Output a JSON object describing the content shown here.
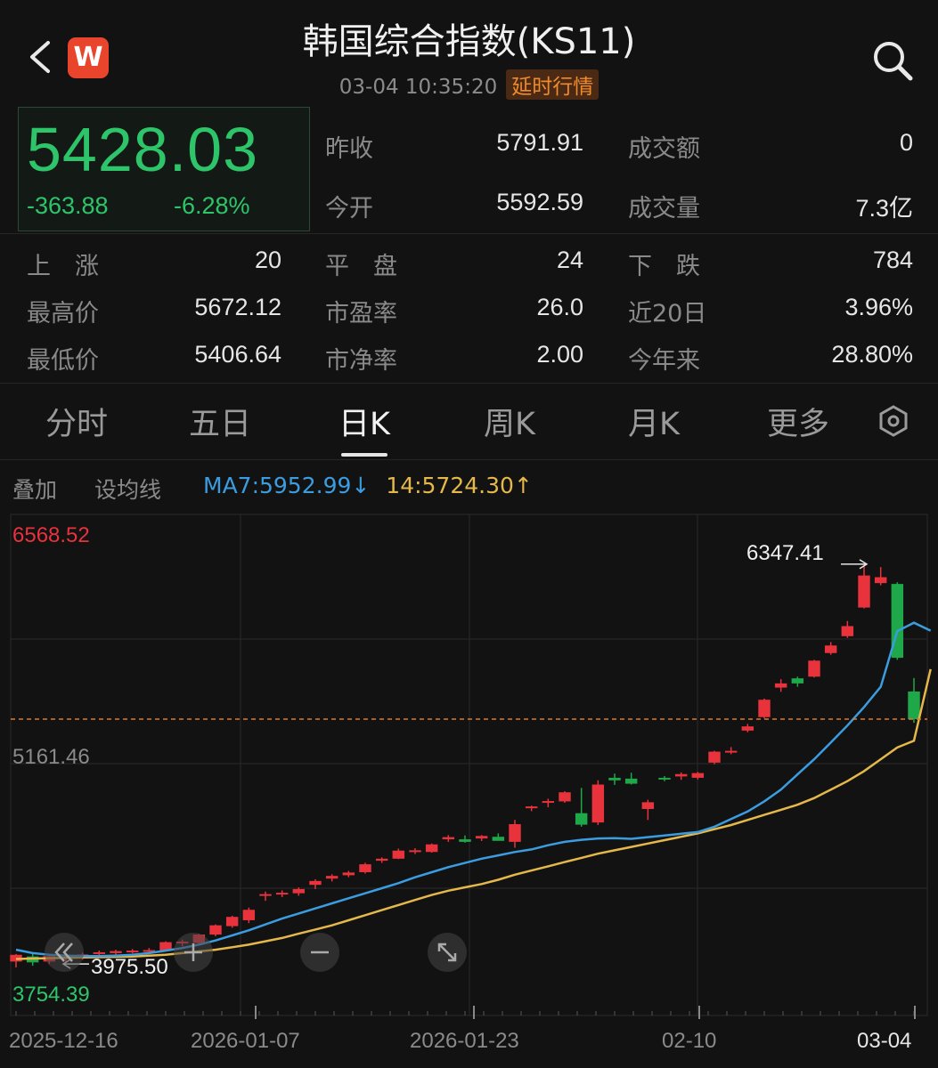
{
  "header": {
    "title": "韩国综合指数(KS11)",
    "datetime": "03-04 10:35:20",
    "delay_tag": "延时行情",
    "logo_letter": "W"
  },
  "quote": {
    "price": "5428.03",
    "change": "-363.88",
    "change_pct": "-6.28%",
    "fields": [
      {
        "label": "昨收",
        "value": "5791.91"
      },
      {
        "label": "今开",
        "value": "5592.59"
      },
      {
        "label": "成交额",
        "value": "0"
      },
      {
        "label": "成交量",
        "value": "7.3亿"
      }
    ]
  },
  "stats": {
    "up_label": "上　涨",
    "up_value": "20",
    "flat_label": "平　盘",
    "flat_value": "24",
    "down_label": "下　跌",
    "down_value": "784",
    "high_label": "最高价",
    "high_value": "5672.12",
    "pe_label": "市盈率",
    "pe_value": "26.0",
    "d20_label": "近20日",
    "d20_value": "3.96%",
    "low_label": "最低价",
    "low_value": "5406.64",
    "pb_label": "市净率",
    "pb_value": "2.00",
    "ytd_label": "今年来",
    "ytd_value": "28.80%"
  },
  "tabs": [
    "分时",
    "五日",
    "日K",
    "周K",
    "月K",
    "更多"
  ],
  "active_tab": "日K",
  "toolbar": {
    "overlay": "叠加",
    "set_ma": "设均线",
    "ma7_text": "MA7:5952.99↓",
    "ma14_text": "14:5724.30↑"
  },
  "chart_data": {
    "type": "candlestick",
    "y_max_label": "6568.52",
    "y_mid_label": "5161.46",
    "y_min_label": "3754.39",
    "high_marker": "6347.41",
    "low_marker": "3975.50",
    "dates": [
      "2025-12-16",
      "2026-01-07",
      "2026-01-23",
      "02-10",
      "03-04"
    ],
    "ylim": [
      3754.39,
      6568.52
    ],
    "current_price": 5428.03,
    "colors": {
      "up": "#e8323c",
      "down": "#1fa84a",
      "ma7": "#3b9de0",
      "ma14": "#e4b84a"
    },
    "candles": [
      {
        "o": 3990,
        "h": 4035,
        "l": 3955,
        "c": 4030
      },
      {
        "o": 4020,
        "h": 4040,
        "l": 3965,
        "c": 3985
      },
      {
        "o": 3990,
        "h": 4035,
        "l": 3975,
        "c": 4022
      },
      {
        "o": 4010,
        "h": 4035,
        "l": 3985,
        "c": 4028
      },
      {
        "o": 4015,
        "h": 4042,
        "l": 4000,
        "c": 4032
      },
      {
        "o": 4040,
        "h": 4055,
        "l": 4025,
        "c": 4045
      },
      {
        "o": 4040,
        "h": 4060,
        "l": 4028,
        "c": 4052
      },
      {
        "o": 4045,
        "h": 4064,
        "l": 4038,
        "c": 4055
      },
      {
        "o": 4050,
        "h": 4070,
        "l": 4045,
        "c": 4058
      },
      {
        "o": 4055,
        "h": 4110,
        "l": 4050,
        "c": 4105
      },
      {
        "o": 4098,
        "h": 4120,
        "l": 4080,
        "c": 4108
      },
      {
        "o": 4100,
        "h": 4155,
        "l": 4095,
        "c": 4150
      },
      {
        "o": 4150,
        "h": 4210,
        "l": 4140,
        "c": 4205
      },
      {
        "o": 4200,
        "h": 4262,
        "l": 4190,
        "c": 4255
      },
      {
        "o": 4235,
        "h": 4310,
        "l": 4218,
        "c": 4297
      },
      {
        "o": 4380,
        "h": 4405,
        "l": 4350,
        "c": 4390
      },
      {
        "o": 4388,
        "h": 4412,
        "l": 4372,
        "c": 4398
      },
      {
        "o": 4395,
        "h": 4430,
        "l": 4380,
        "c": 4420
      },
      {
        "o": 4445,
        "h": 4478,
        "l": 4420,
        "c": 4468
      },
      {
        "o": 4482,
        "h": 4508,
        "l": 4465,
        "c": 4498
      },
      {
        "o": 4502,
        "h": 4528,
        "l": 4490,
        "c": 4518
      },
      {
        "o": 4520,
        "h": 4576,
        "l": 4512,
        "c": 4567
      },
      {
        "o": 4588,
        "h": 4608,
        "l": 4575,
        "c": 4600
      },
      {
        "o": 4600,
        "h": 4660,
        "l": 4598,
        "c": 4648
      },
      {
        "o": 4645,
        "h": 4662,
        "l": 4628,
        "c": 4650
      },
      {
        "o": 4640,
        "h": 4690,
        "l": 4636,
        "c": 4685
      },
      {
        "o": 4715,
        "h": 4740,
        "l": 4700,
        "c": 4728
      },
      {
        "o": 4715,
        "h": 4738,
        "l": 4695,
        "c": 4700
      },
      {
        "o": 4720,
        "h": 4740,
        "l": 4705,
        "c": 4735
      },
      {
        "o": 4730,
        "h": 4750,
        "l": 4712,
        "c": 4706
      },
      {
        "o": 4700,
        "h": 4830,
        "l": 4665,
        "c": 4805
      },
      {
        "o": 4902,
        "h": 4915,
        "l": 4882,
        "c": 4910
      },
      {
        "o": 4942,
        "h": 4956,
        "l": 4905,
        "c": 4942
      },
      {
        "o": 4940,
        "h": 5000,
        "l": 4932,
        "c": 4994
      },
      {
        "o": 4870,
        "h": 5020,
        "l": 4790,
        "c": 4802
      },
      {
        "o": 4815,
        "h": 5065,
        "l": 4800,
        "c": 5040
      },
      {
        "o": 5080,
        "h": 5105,
        "l": 5038,
        "c": 5065
      },
      {
        "o": 5075,
        "h": 5110,
        "l": 5040,
        "c": 5045
      },
      {
        "o": 4895,
        "h": 4950,
        "l": 4830,
        "c": 4935
      },
      {
        "o": 5080,
        "h": 5090,
        "l": 5060,
        "c": 5072
      },
      {
        "o": 5088,
        "h": 5112,
        "l": 5068,
        "c": 5102
      },
      {
        "o": 5080,
        "h": 5115,
        "l": 5070,
        "c": 5108
      },
      {
        "o": 5170,
        "h": 5240,
        "l": 5160,
        "c": 5235
      },
      {
        "o": 5235,
        "h": 5262,
        "l": 5220,
        "c": 5240
      },
      {
        "o": 5360,
        "h": 5400,
        "l": 5350,
        "c": 5385
      },
      {
        "o": 5440,
        "h": 5550,
        "l": 5432,
        "c": 5543
      },
      {
        "o": 5615,
        "h": 5665,
        "l": 5590,
        "c": 5640
      },
      {
        "o": 5670,
        "h": 5680,
        "l": 5620,
        "c": 5640
      },
      {
        "o": 5680,
        "h": 5780,
        "l": 5675,
        "c": 5775
      },
      {
        "o": 5820,
        "h": 5885,
        "l": 5810,
        "c": 5865
      },
      {
        "o": 5920,
        "h": 6010,
        "l": 5910,
        "c": 5980
      },
      {
        "o": 6090,
        "h": 6347,
        "l": 6085,
        "c": 6280
      },
      {
        "o": 6235,
        "h": 6330,
        "l": 6222,
        "c": 6270
      },
      {
        "o": 6230,
        "h": 6240,
        "l": 5780,
        "c": 5792
      },
      {
        "o": 5592,
        "h": 5672,
        "l": 5406,
        "c": 5428
      }
    ],
    "ma7": [
      4060,
      4040,
      4030,
      4025,
      4022,
      4022,
      4025,
      4030,
      4040,
      4055,
      4070,
      4090,
      4115,
      4145,
      4175,
      4210,
      4245,
      4275,
      4305,
      4335,
      4365,
      4395,
      4425,
      4455,
      4490,
      4520,
      4550,
      4575,
      4600,
      4620,
      4640,
      4655,
      4680,
      4700,
      4712,
      4720,
      4722,
      4718,
      4728,
      4738,
      4748,
      4758,
      4790,
      4835,
      4880,
      4940,
      5010,
      5100,
      5190,
      5290,
      5390,
      5500,
      5620,
      5950,
      6000,
      5952.99
    ],
    "ma14": [
      4005,
      4008,
      4010,
      4012,
      4014,
      4016,
      4018,
      4020,
      4025,
      4030,
      4040,
      4050,
      4060,
      4075,
      4090,
      4110,
      4130,
      4155,
      4180,
      4205,
      4235,
      4265,
      4295,
      4325,
      4355,
      4385,
      4410,
      4430,
      4450,
      4475,
      4505,
      4530,
      4555,
      4580,
      4605,
      4630,
      4650,
      4670,
      4690,
      4710,
      4730,
      4750,
      4775,
      4800,
      4830,
      4860,
      4890,
      4920,
      4960,
      5010,
      5060,
      5120,
      5190,
      5260,
      5300,
      5724.3
    ]
  }
}
